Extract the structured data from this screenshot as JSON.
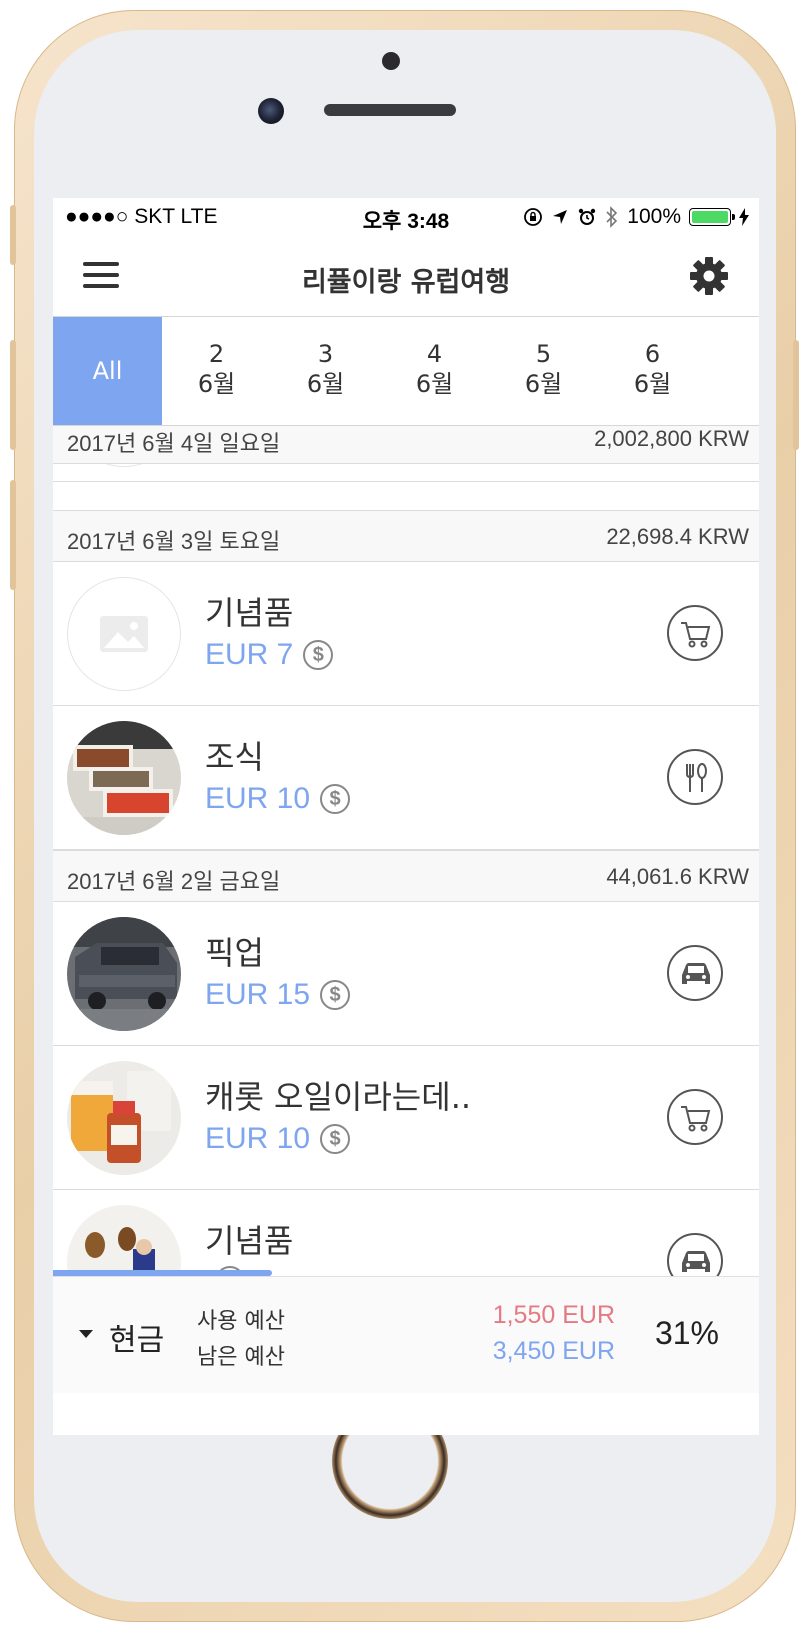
{
  "status_bar": {
    "carrier": "●●●●○ SKT  LTE",
    "time": "오후 3:48",
    "battery": "100%"
  },
  "header": {
    "title": "리퓰이랑 유럽여행",
    "menu_icon": "hamburger-icon",
    "settings_icon": "gear-icon"
  },
  "tabs": [
    {
      "label": "All",
      "active": true
    },
    {
      "day": "2",
      "month": "6월"
    },
    {
      "day": "3",
      "month": "6월"
    },
    {
      "day": "4",
      "month": "6월"
    },
    {
      "day": "5",
      "month": "6월"
    },
    {
      "day": "6",
      "month": "6월"
    }
  ],
  "sections": [
    {
      "date": "2017년 6월 4일 일요일",
      "total": "2,002,800 KRW"
    },
    {
      "date": "2017년 6월 3일 토요일",
      "total": "22,698.4 KRW"
    },
    {
      "date": "2017년 6월 2일 금요일",
      "total": "44,061.6 KRW"
    }
  ],
  "items": [
    {
      "name": "기념품",
      "amount": "EUR 7",
      "payment_icon": "dollar-icon",
      "category_icon": "cart-icon",
      "thumb": "placeholder-image"
    },
    {
      "name": "조식",
      "amount": "EUR 10",
      "payment_icon": "dollar-icon",
      "category_icon": "utensils-icon",
      "thumb": "breakfast-photo"
    },
    {
      "name": "픽업",
      "amount": "EUR 15",
      "payment_icon": "dollar-icon",
      "category_icon": "car-icon",
      "thumb": "van-photo"
    },
    {
      "name": "캐롯 오일이라는데..",
      "amount": "EUR 10",
      "payment_icon": "dollar-icon",
      "category_icon": "cart-icon",
      "thumb": "product-photo"
    },
    {
      "name": "기념품",
      "amount": "",
      "payment_icon": "dollar-icon",
      "category_icon": "car-icon",
      "thumb": "souvenir-photo"
    }
  ],
  "footer": {
    "payment_method": "현금",
    "used_label": "사용 예산",
    "remaining_label": "남은 예산",
    "used_value": "1,550 EUR",
    "remaining_value": "3,450 EUR",
    "percent": "31%",
    "progress_fraction": 0.31
  },
  "colors": {
    "accent": "#7ea5ef",
    "used": "#e37a84",
    "remaining": "#7ea5ef"
  }
}
